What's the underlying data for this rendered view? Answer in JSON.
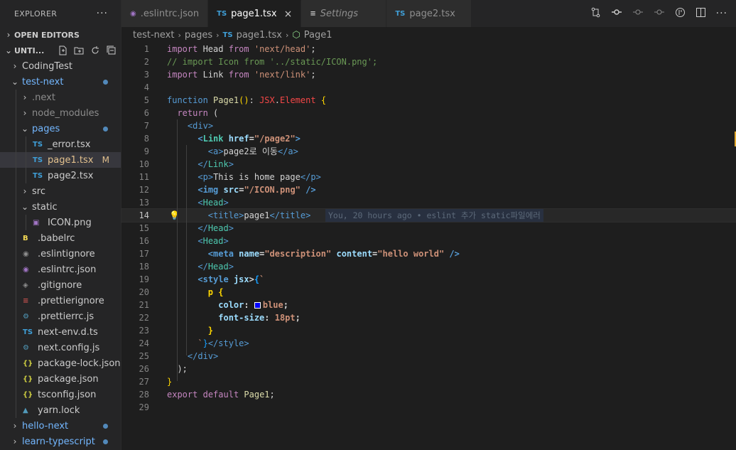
{
  "explorer": {
    "title": "EXPLORER",
    "more": "···",
    "open_editors": "OPEN EDITORS",
    "workspace": "UNTI...",
    "items": [
      {
        "label": "CodingTest",
        "depth": 1,
        "type": "folder",
        "open": false
      },
      {
        "label": "test-next",
        "depth": 1,
        "type": "folder",
        "open": true,
        "git": true,
        "dot": true
      },
      {
        "label": ".next",
        "depth": 2,
        "type": "folder",
        "open": false,
        "dim": true
      },
      {
        "label": "node_modules",
        "depth": 2,
        "type": "folder",
        "open": false,
        "dim": true
      },
      {
        "label": "pages",
        "depth": 2,
        "type": "folder",
        "open": true,
        "git": true,
        "dot": true
      },
      {
        "label": "_error.tsx",
        "depth": 3,
        "type": "ts"
      },
      {
        "label": "page1.tsx",
        "depth": 3,
        "type": "ts",
        "selected": true,
        "badge": "M"
      },
      {
        "label": "page2.tsx",
        "depth": 3,
        "type": "ts"
      },
      {
        "label": "src",
        "depth": 2,
        "type": "folder",
        "open": false
      },
      {
        "label": "static",
        "depth": 2,
        "type": "folder",
        "open": true
      },
      {
        "label": "ICON.png",
        "depth": 3,
        "type": "image"
      },
      {
        "label": ".babelrc",
        "depth": 2,
        "type": "babel"
      },
      {
        "label": ".eslintignore",
        "depth": 2,
        "type": "eslintignore"
      },
      {
        "label": ".eslintrc.json",
        "depth": 2,
        "type": "eslint"
      },
      {
        "label": ".gitignore",
        "depth": 2,
        "type": "git"
      },
      {
        "label": ".prettierignore",
        "depth": 2,
        "type": "prettierignore"
      },
      {
        "label": ".prettierrc.js",
        "depth": 2,
        "type": "prettier"
      },
      {
        "label": "next-env.d.ts",
        "depth": 2,
        "type": "ts"
      },
      {
        "label": "next.config.js",
        "depth": 2,
        "type": "config"
      },
      {
        "label": "package-lock.json",
        "depth": 2,
        "type": "json"
      },
      {
        "label": "package.json",
        "depth": 2,
        "type": "json"
      },
      {
        "label": "tsconfig.json",
        "depth": 2,
        "type": "json"
      },
      {
        "label": "yarn.lock",
        "depth": 2,
        "type": "yarn"
      },
      {
        "label": "hello-next",
        "depth": 1,
        "type": "folder",
        "open": false,
        "git": true,
        "dot": true
      },
      {
        "label": "learn-typescript",
        "depth": 1,
        "type": "folder",
        "open": false,
        "git": true,
        "dot": true
      }
    ]
  },
  "tabs": [
    {
      "label": ".eslintrc.json",
      "icon": "eslint-icon"
    },
    {
      "label": "page1.tsx",
      "icon": "ts-icon",
      "active": true,
      "close": "×"
    },
    {
      "label": "Settings",
      "icon": "settings-icon",
      "italic": true
    },
    {
      "label": "page2.tsx",
      "icon": "ts-icon"
    }
  ],
  "breadcrumb": [
    "test-next",
    "pages",
    "page1.tsx",
    "Page1"
  ],
  "blame": "You, 20 hours ago • eslint 추가 static파일에러",
  "current_line": 14,
  "line_numbers": [
    "1",
    "2",
    "3",
    "4",
    "5",
    "6",
    "7",
    "8",
    "9",
    "10",
    "11",
    "12",
    "13",
    "14",
    "15",
    "16",
    "17",
    "18",
    "19",
    "20",
    "21",
    "22",
    "23",
    "24",
    "25",
    "26",
    "27",
    "28",
    "29"
  ],
  "code": {
    "l1": [
      "import",
      " Head ",
      "from",
      " ",
      "'next/head'",
      ";"
    ],
    "l2": "// import Icon from '../static/ICON.png';",
    "l3": [
      "import",
      " Link ",
      "from",
      " ",
      "'next/link'",
      ";"
    ],
    "l5": [
      "function",
      " ",
      "Page1",
      "()",
      ":",
      " ",
      "JSX",
      ".",
      "Element",
      " ",
      "{"
    ],
    "l6": [
      "return",
      " ("
    ],
    "l7": [
      "<",
      "div",
      ">"
    ],
    "l8": [
      "<",
      "Link",
      " ",
      "href",
      "=",
      "\"/page2\"",
      ">"
    ],
    "l9": [
      "<",
      "a",
      ">",
      "page2로 이동",
      "</",
      "a",
      ">"
    ],
    "l10": [
      "</",
      "Link",
      ">"
    ],
    "l11": [
      "<",
      "p",
      ">",
      "This is home page",
      "</",
      "p",
      ">"
    ],
    "l12": [
      "<",
      "img",
      " ",
      "src",
      "=",
      "\"/ICON.png\"",
      " />"
    ],
    "l13": [
      "<",
      "Head",
      ">"
    ],
    "l14": [
      "<",
      "title",
      ">",
      "page1",
      "</",
      "title",
      ">"
    ],
    "l15": [
      "</",
      "Head",
      ">"
    ],
    "l16": [
      "<",
      "Head",
      ">"
    ],
    "l17": [
      "<",
      "meta",
      " ",
      "name",
      "=",
      "\"description\"",
      " ",
      "content",
      "=",
      "\"hello world\"",
      " />"
    ],
    "l18": [
      "</",
      "Head",
      ">"
    ],
    "l19": [
      "<",
      "style",
      " ",
      "jsx",
      ">",
      "{",
      "`"
    ],
    "l20": [
      "p",
      " {"
    ],
    "l21": [
      "color",
      ": ",
      "blue",
      ";"
    ],
    "l22": [
      "font-size",
      ": ",
      "18pt",
      ";"
    ],
    "l23": [
      "}"
    ],
    "l24": [
      "`",
      "}",
      "</",
      "style",
      ">"
    ],
    "l25": [
      "</",
      "div",
      ">"
    ],
    "l26": [
      ");"
    ],
    "l27": [
      "}"
    ],
    "l28": [
      "export",
      " ",
      "default",
      " ",
      "Page1",
      ";"
    ]
  },
  "colors": {
    "accent": "#007acc",
    "git_added": "#73b7ff",
    "modified": "#e2c08d"
  }
}
